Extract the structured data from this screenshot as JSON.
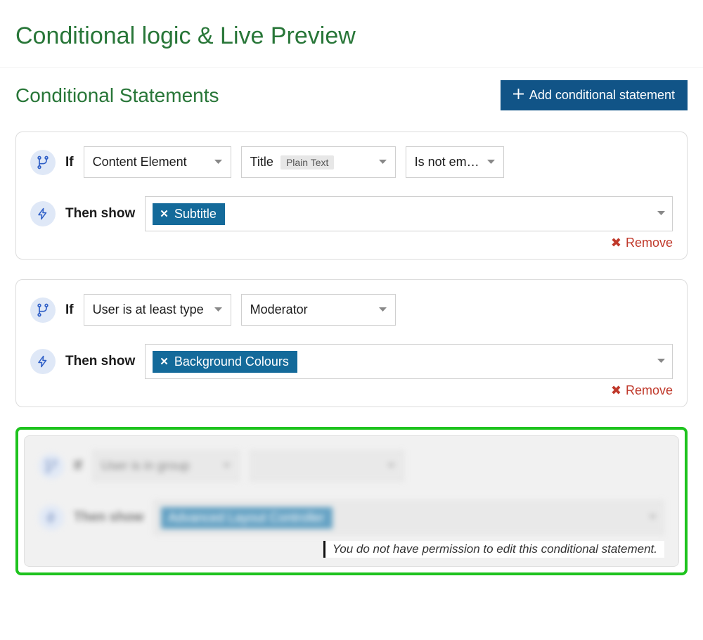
{
  "page": {
    "title": "Conditional logic & Live Preview",
    "section_title": "Conditional Statements",
    "add_button": "Add conditional statement"
  },
  "labels": {
    "if": "If",
    "then_show": "Then show",
    "remove": "Remove"
  },
  "statements": [
    {
      "condition_type": "Content Element",
      "field_label": "Title",
      "field_kind": "Plain Text",
      "operator": "Is not em…",
      "show_tags": [
        "Subtitle"
      ]
    },
    {
      "condition_type": "User is at least type",
      "role": "Moderator",
      "show_tags": [
        "Background Colours"
      ]
    }
  ],
  "locked": {
    "condition_type": "User is in group",
    "value": "",
    "show_tags": [
      "Advanced Layout Controller"
    ],
    "message": "You do not have permission to edit this conditional statement."
  }
}
